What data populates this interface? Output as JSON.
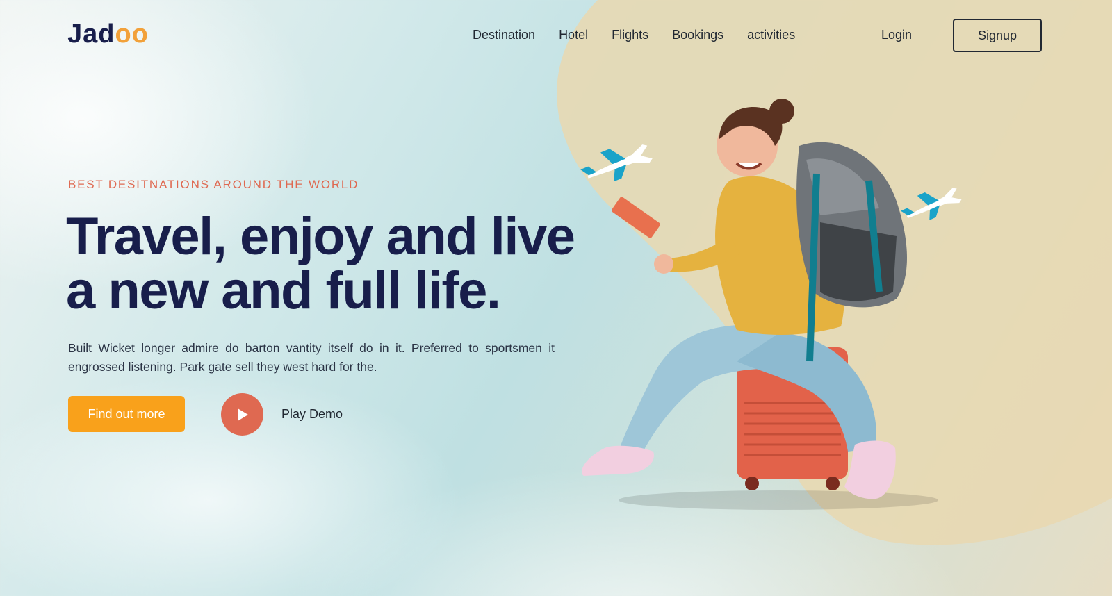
{
  "brand": {
    "logo_prefix": "Jad",
    "logo_suffix": "oo"
  },
  "nav": {
    "items": [
      {
        "label": "Destination"
      },
      {
        "label": "Hotel"
      },
      {
        "label": "Flights"
      },
      {
        "label": "Bookings"
      },
      {
        "label": "activities"
      }
    ],
    "login_label": "Login",
    "signup_label": "Signup"
  },
  "hero": {
    "eyebrow": "BEST DESITNATIONS AROUND THE WORLD",
    "headline_line1": "Travel, enjoy and live",
    "headline_line2": "a new and full life.",
    "description": "Built Wicket longer admire do barton vantity itself do in it. Preferred to sportsmen it engrossed listening. Park gate sell they west hard for the.",
    "cta_label": "Find out more",
    "play_label": "Play Demo"
  },
  "colors": {
    "accent_orange": "#f9a11b",
    "accent_red": "#df6951",
    "text_dark": "#181e4b",
    "blob": "#ead9b2"
  },
  "icons": {
    "play": "play-icon",
    "plane": "airplane-icon"
  }
}
